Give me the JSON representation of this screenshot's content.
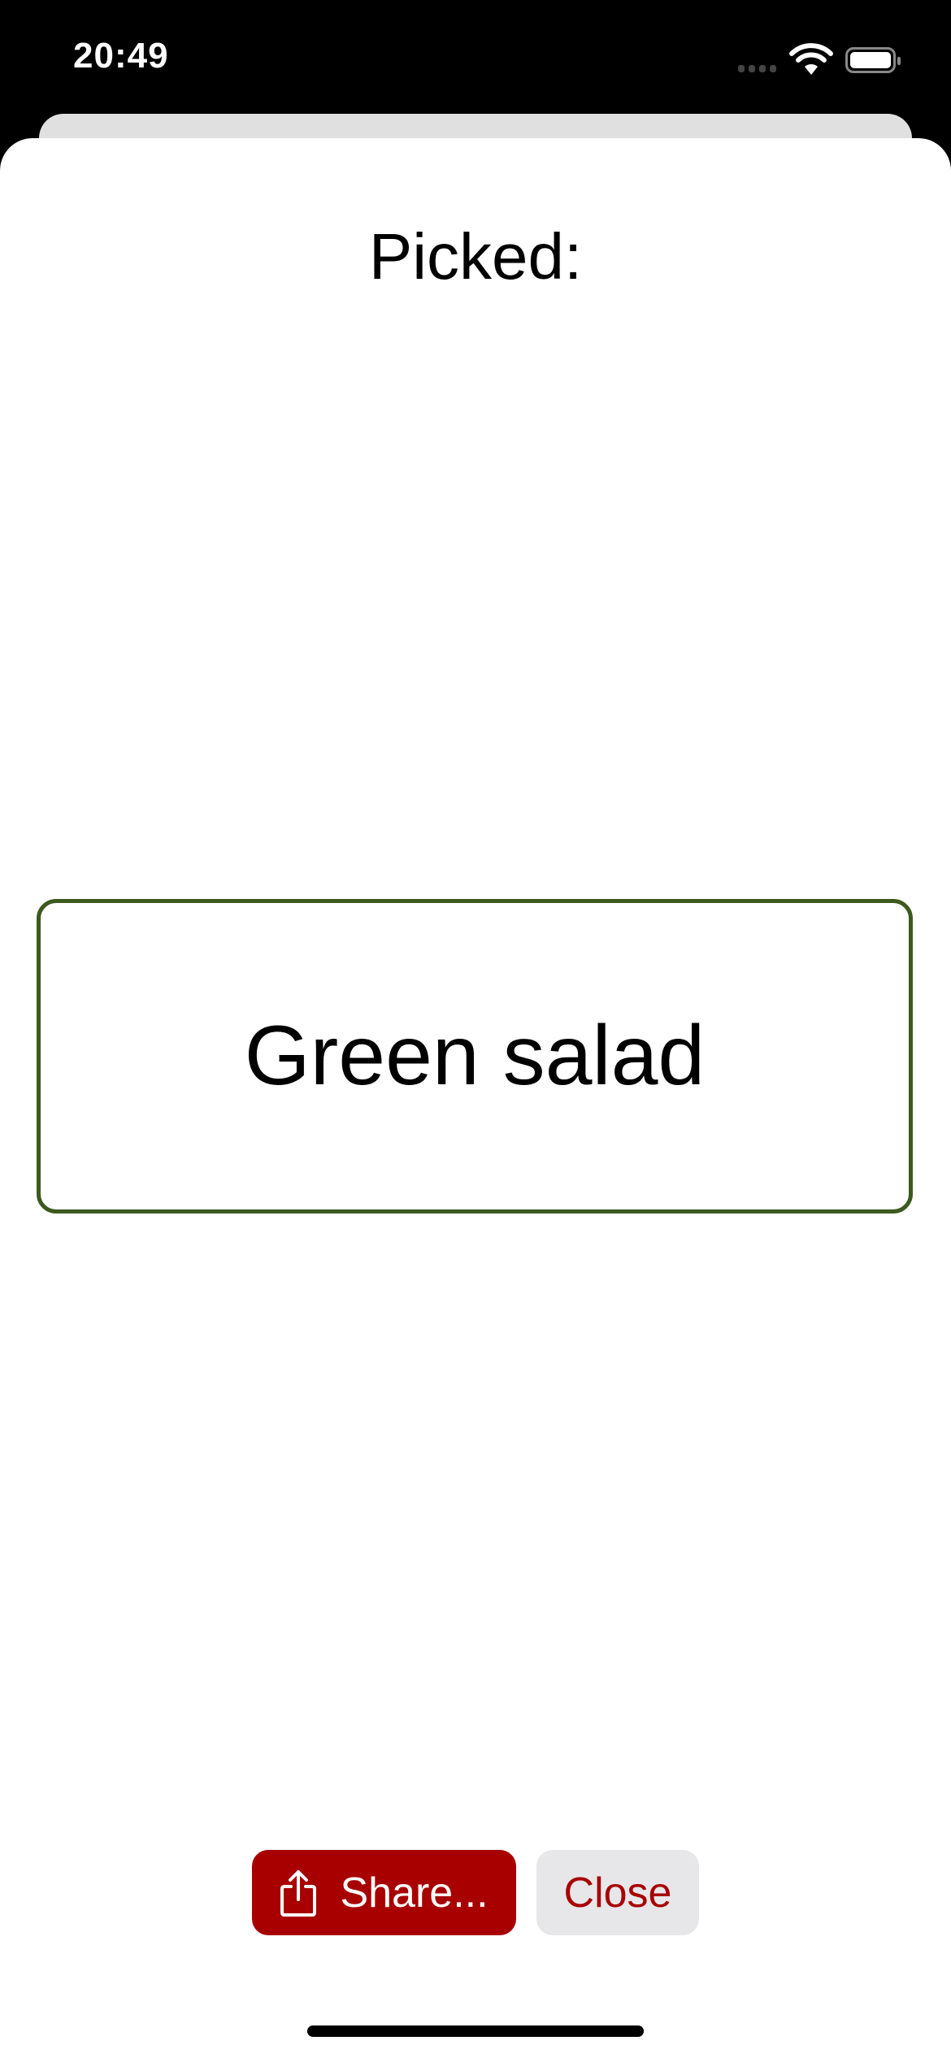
{
  "status_bar": {
    "time": "20:49"
  },
  "sheet": {
    "title": "Picked:",
    "picked_item": "Green salad",
    "share_label": "Share...",
    "close_label": "Close"
  },
  "colors": {
    "accent": "#a80000",
    "card_border": "#3d5a1e",
    "close_bg": "#e7e7ea"
  }
}
